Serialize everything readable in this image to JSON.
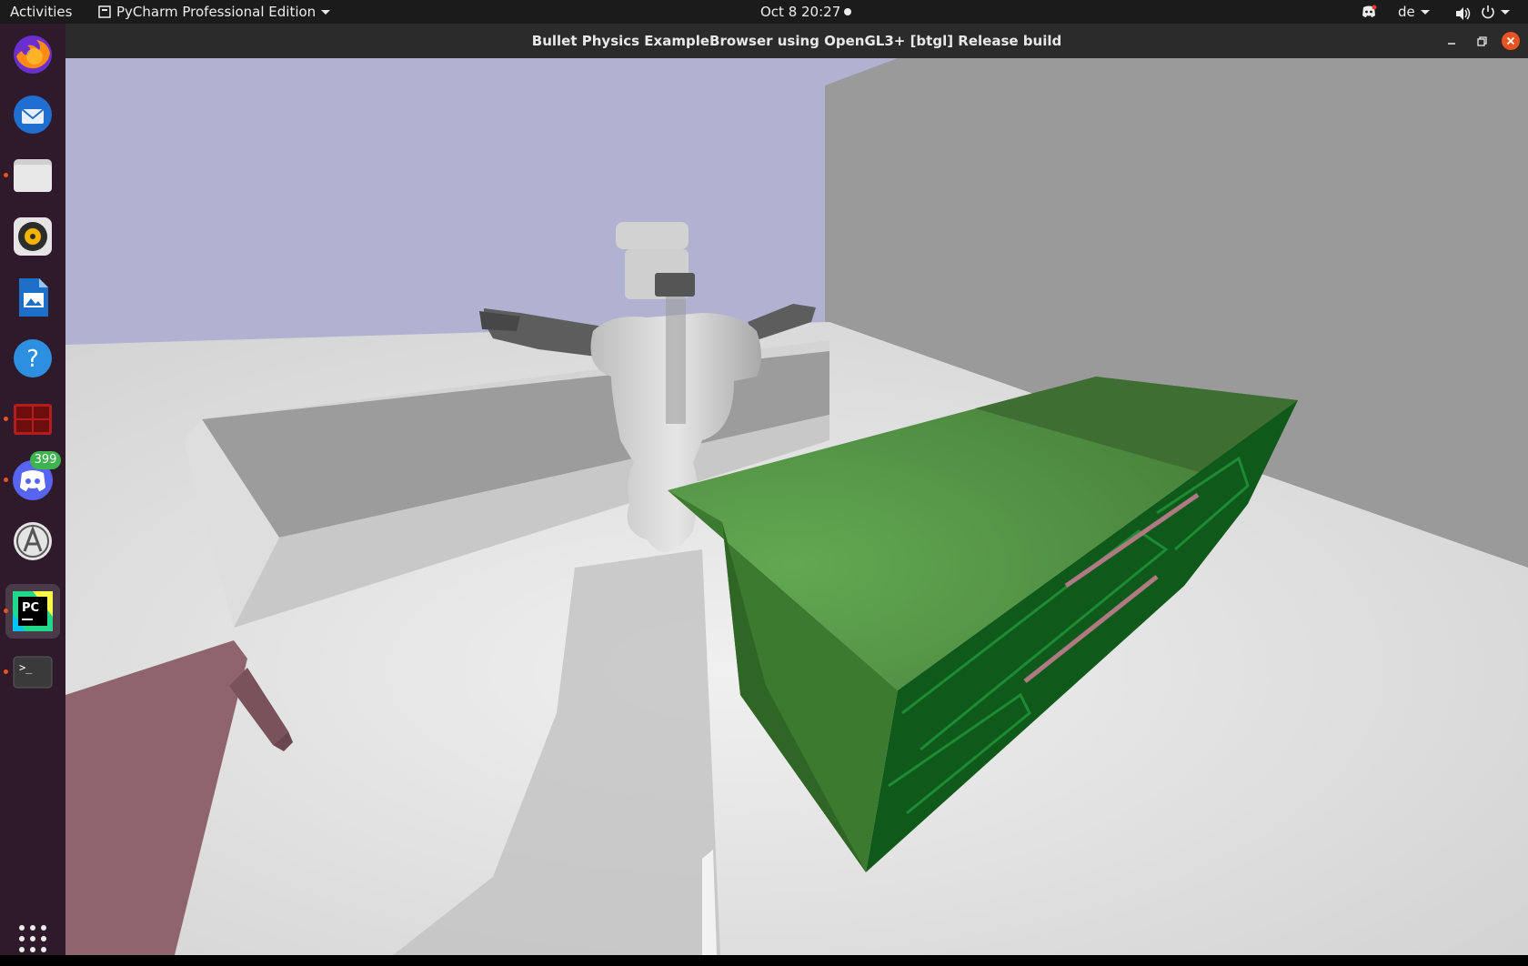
{
  "topbar": {
    "activities": "Activities",
    "app_menu": "PyCharm Professional Edition",
    "clock": "Oct 8  20:27",
    "keyboard_layout": "de"
  },
  "dock": {
    "items": [
      {
        "name": "Firefox",
        "icon": "firefox-icon"
      },
      {
        "name": "Thunderbird",
        "icon": "thunderbird-icon"
      },
      {
        "name": "Files",
        "icon": "files-icon"
      },
      {
        "name": "Rhythmbox",
        "icon": "rhythmbox-icon"
      },
      {
        "name": "LibreOffice Writer",
        "icon": "writer-icon"
      },
      {
        "name": "Help",
        "icon": "help-icon"
      },
      {
        "name": "Terminator",
        "icon": "terminator-icon"
      },
      {
        "name": "Discord",
        "icon": "discord-icon",
        "badge": "399"
      },
      {
        "name": "Software",
        "icon": "software-icon"
      },
      {
        "name": "PyCharm",
        "icon": "pycharm-icon",
        "active": true
      },
      {
        "name": "Terminal",
        "icon": "terminal-icon"
      },
      {
        "name": "Show Applications",
        "icon": "app-grid-icon"
      }
    ]
  },
  "window": {
    "title": "Bullet Physics ExampleBrowser using OpenGL3+ [btgl] Release build"
  },
  "colors": {
    "ubuntu_orange": "#e95420",
    "dock_bg": "#2e1a2b",
    "topbar_bg": "#1b1b1b",
    "sky": "#b0b0d0",
    "floor": "#dcdcdc",
    "cabinet_green": "#4a7f3a"
  }
}
